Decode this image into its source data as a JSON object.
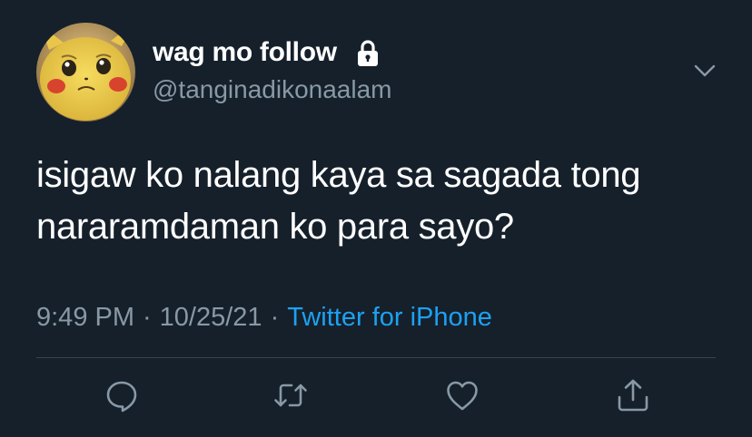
{
  "user": {
    "display_name": "wag mo follow",
    "handle": "@tanginadikonaalam",
    "protected_icon": "lock-icon",
    "avatar": "avatar-image"
  },
  "tweet": {
    "text_line1": "isigaw ko nalang kaya sa sagada tong",
    "text_line2": "nararamdaman ko para sayo?",
    "time": "9:49 PM",
    "separator": "·",
    "date": "10/25/21",
    "source": "Twitter for iPhone"
  },
  "actions": [
    {
      "name": "reply",
      "icon": "comment-icon"
    },
    {
      "name": "retweet",
      "icon": "retweet-icon"
    },
    {
      "name": "like",
      "icon": "heart-icon"
    },
    {
      "name": "share",
      "icon": "share-icon"
    }
  ],
  "colors": {
    "background": "#15202b",
    "text": "#ffffff",
    "secondary": "#8899a6",
    "link": "#1da1f2",
    "divider": "#38444d"
  }
}
